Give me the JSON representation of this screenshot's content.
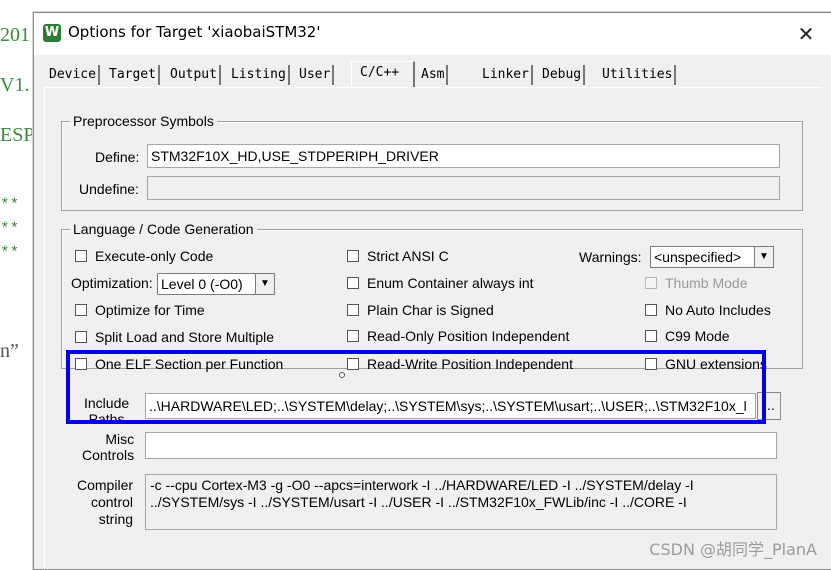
{
  "background": {
    "lines": [
      "201",
      "V1.",
      "ESP",
      "**",
      "**",
      "**",
      "n”"
    ]
  },
  "dialog": {
    "title": "Options for Target 'xiaobaiSTM32'",
    "close_symbol": "✕",
    "app_icon_glyph": "W"
  },
  "tabs": [
    "Device",
    "Target",
    "Output",
    "Listing",
    "User",
    "C/C++",
    "Asm",
    "Linker",
    "Debug",
    "Utilities"
  ],
  "active_tab": "C/C++",
  "preprocessor": {
    "group_label": "Preprocessor Symbols",
    "define_label": "Define:",
    "define_value": "STM32F10X_HD,USE_STDPERIPH_DRIVER",
    "undefine_label": "Undefine:",
    "undefine_value": ""
  },
  "language": {
    "group_label": "Language / Code Generation",
    "execute_only": "Execute-only Code",
    "optimization_label": "Optimization:",
    "optimization_value": "Level 0 (-O0)",
    "optimize_time": "Optimize for Time",
    "split_load": "Split Load and Store Multiple",
    "one_elf": "One ELF Section per Function",
    "strict_ansi": "Strict ANSI C",
    "enum_container": "Enum Container always int",
    "plain_char": "Plain Char is Signed",
    "ro_pos": "Read-Only Position Independent",
    "rw_pos": "Read-Write Position Independent",
    "warnings_label": "Warnings:",
    "warnings_value": "<unspecified>",
    "thumb_mode": "Thumb Mode",
    "no_auto_includes": "No Auto Includes",
    "c99_mode": "C99 Mode",
    "gnu_extensions": "GNU extensions"
  },
  "include": {
    "label_line1": "Include",
    "label_line2": "Paths",
    "value": "..\\HARDWARE\\LED;..\\SYSTEM\\delay;..\\SYSTEM\\sys;..\\SYSTEM\\usart;..\\USER;..\\STM32F10x_l",
    "browse_label": "..."
  },
  "misc": {
    "label_line1": "Misc",
    "label_line2": "Controls",
    "value": ""
  },
  "compiler": {
    "label_line1": "Compiler",
    "label_line2": "control",
    "label_line3": "string",
    "line1": "-c --cpu Cortex-M3 -g -O0 --apcs=interwork -I ../HARDWARE/LED -I ../SYSTEM/delay -I",
    "line2": "../SYSTEM/sys -I ../SYSTEM/usart -I ../USER -I ../STM32F10x_FWLib/inc -I ../CORE -I"
  },
  "watermark": "CSDN @胡同学_PlanA",
  "colors": {
    "highlight_rect": "#0000e6",
    "dialog_bg": "#f0f0f0",
    "background_code_green": "#3a8a3a"
  }
}
